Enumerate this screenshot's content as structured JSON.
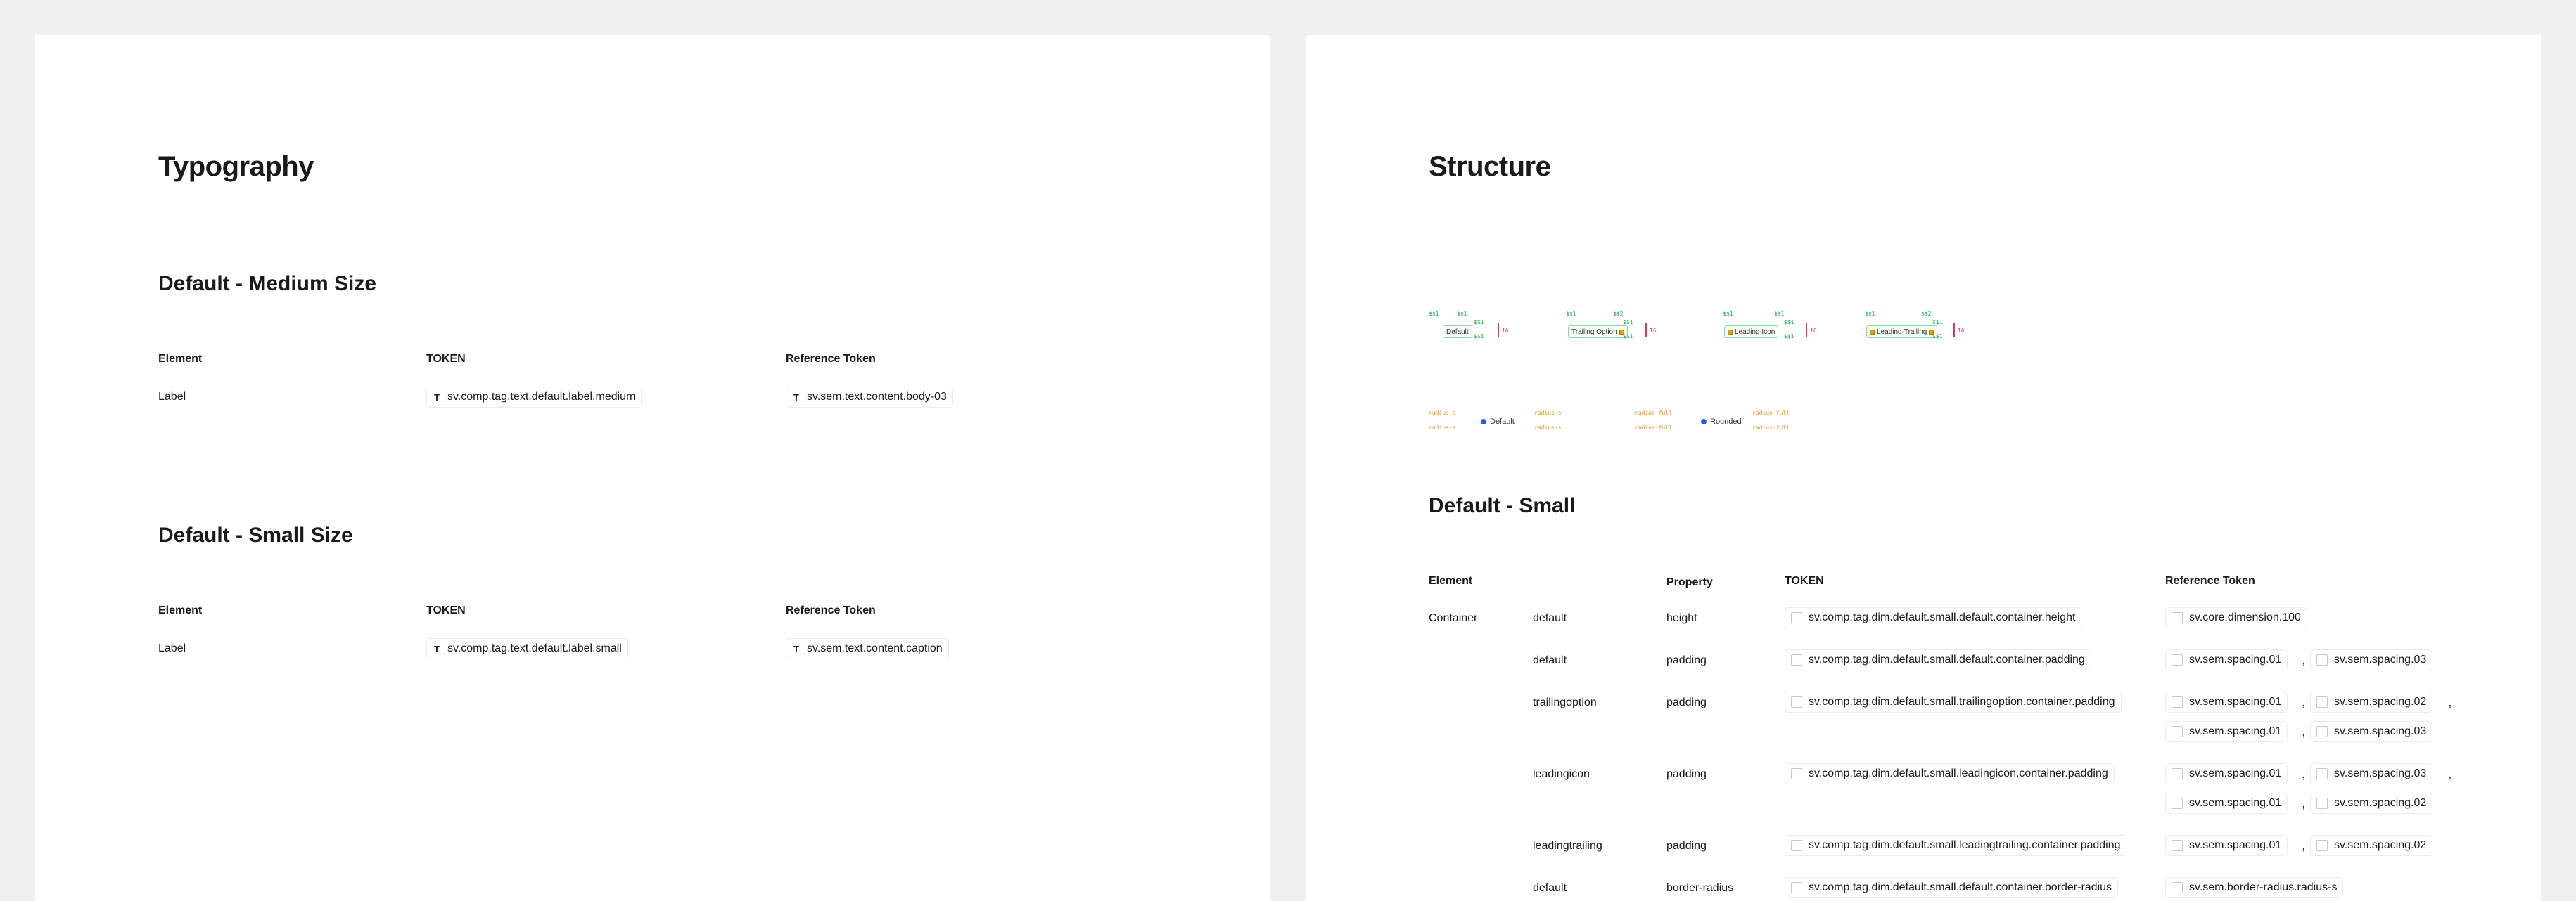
{
  "typography": {
    "title": "Typography",
    "sections": [
      {
        "heading": "Default - Medium Size",
        "columns": [
          "Element",
          "TOKEN",
          "Reference Token"
        ],
        "rows": [
          {
            "element": "Label",
            "token": "sv.comp.tag.text.default.label.medium",
            "ref": "sv.sem.text.content.body-03",
            "token_icon": "T",
            "ref_icon": "T"
          }
        ]
      },
      {
        "heading": "Default - Small Size",
        "columns": [
          "Element",
          "TOKEN",
          "Reference Token"
        ],
        "rows": [
          {
            "element": "Label",
            "token": "sv.comp.tag.text.default.label.small",
            "ref": "sv.sem.text.content.caption",
            "token_icon": "T",
            "ref_icon": "T"
          }
        ]
      }
    ]
  },
  "structure": {
    "title": "Structure",
    "diagram": {
      "variants": [
        "Default",
        "Trailing Option",
        "Leading Icon",
        "Leading-Trailing"
      ],
      "spacing_label": "$$1",
      "spacing_label_2": "$$2",
      "height_label": "16",
      "radius_label_s": "radius-s",
      "radius_label_full": "radius-full",
      "shape_variants": [
        "Default",
        "Rounded"
      ]
    },
    "section_heading": "Default - Small",
    "columns": {
      "element": "Element",
      "property": "Property",
      "token": "TOKEN",
      "ref": "Reference Token"
    },
    "rows": [
      {
        "element": "Container",
        "variant": "default",
        "property": "height",
        "token": "sv.comp.tag.dim.default.small.default.container.height",
        "refs": [
          "sv.core.dimension.100"
        ]
      },
      {
        "element": "",
        "variant": "default",
        "property": "padding",
        "token": "sv.comp.tag.dim.default.small.default.container.padding",
        "refs": [
          "sv.sem.spacing.01",
          "sv.sem.spacing.03"
        ]
      },
      {
        "element": "",
        "variant": "trailingoption",
        "property": "padding",
        "token": "sv.comp.tag.dim.default.small.trailingoption.container.padding",
        "refs": [
          "sv.sem.spacing.01",
          "sv.sem.spacing.02",
          "sv.sem.spacing.01",
          "sv.sem.spacing.03"
        ]
      },
      {
        "element": "",
        "variant": "leadingicon",
        "property": "padding",
        "token": "sv.comp.tag.dim.default.small.leadingicon.container.padding",
        "refs": [
          "sv.sem.spacing.01",
          "sv.sem.spacing.03",
          "sv.sem.spacing.01",
          "sv.sem.spacing.02"
        ]
      },
      {
        "element": "",
        "variant": "leadingtrailing",
        "property": "padding",
        "token": "sv.comp.tag.dim.default.small.leadingtrailing.container.padding",
        "refs": [
          "sv.sem.spacing.01",
          "sv.sem.spacing.02"
        ]
      },
      {
        "element": "",
        "variant": "default",
        "property": "border-radius",
        "token": "sv.comp.tag.dim.default.small.default.container.border-radius",
        "refs": [
          "sv.sem.border-radius.radius-s"
        ]
      }
    ],
    "separator": ","
  }
}
